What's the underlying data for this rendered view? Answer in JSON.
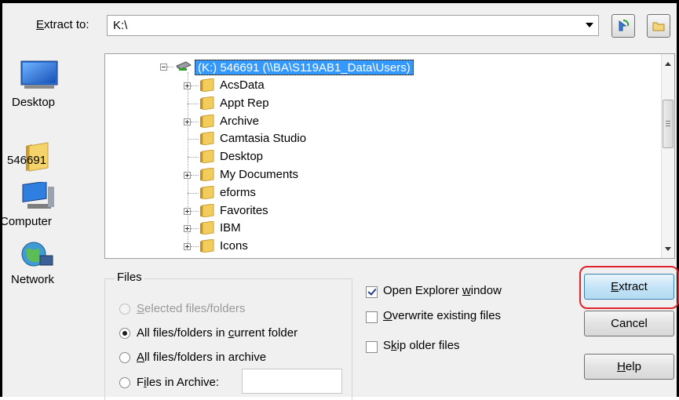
{
  "extract_to": {
    "label_prefix": "E",
    "label_rest": "xtract to:",
    "path": "K:\\"
  },
  "places": [
    {
      "label": "Desktop",
      "icon": "desktop-icon"
    },
    {
      "label": "546691",
      "icon": "user-folder-icon"
    },
    {
      "label": "Computer",
      "icon": "computer-icon"
    },
    {
      "label": "Network",
      "icon": "network-icon"
    }
  ],
  "tree": {
    "root": "(K:) 546691 (\\\\BA\\S119AB1_Data\\Users)",
    "items": [
      {
        "label": "AcsData",
        "expandable": true
      },
      {
        "label": "Appt Rep",
        "expandable": false
      },
      {
        "label": "Archive",
        "expandable": true
      },
      {
        "label": "Camtasia Studio",
        "expandable": false
      },
      {
        "label": "Desktop",
        "expandable": false
      },
      {
        "label": "My Documents",
        "expandable": true
      },
      {
        "label": "eforms",
        "expandable": false
      },
      {
        "label": "Favorites",
        "expandable": true
      },
      {
        "label": "IBM",
        "expandable": true
      },
      {
        "label": "Icons",
        "expandable": true
      }
    ]
  },
  "files_group": {
    "title": "Files",
    "options": [
      {
        "pre": "",
        "u": "S",
        "post": "elected files/folders",
        "checked": false,
        "disabled": true
      },
      {
        "pre": "All files/folders in ",
        "u": "c",
        "post": "urrent folder",
        "checked": true,
        "disabled": false
      },
      {
        "pre": "",
        "u": "A",
        "post": "ll files/folders in archive",
        "checked": false,
        "disabled": false
      },
      {
        "pre": "F",
        "u": "i",
        "post": "les in Archive:",
        "checked": false,
        "disabled": false
      }
    ],
    "files_in_archive_value": ""
  },
  "options": [
    {
      "pre": "Open Explorer ",
      "u": "w",
      "post": "indow",
      "checked": true
    },
    {
      "pre": "",
      "u": "O",
      "post": "verwrite existing files",
      "checked": false
    },
    {
      "pre": "S",
      "u": "k",
      "post": "ip older files",
      "checked": false
    }
  ],
  "buttons": {
    "extract": {
      "u": "E",
      "post": "xtract"
    },
    "cancel": "Cancel",
    "help": {
      "u": "H",
      "post": "elp"
    }
  },
  "colors": {
    "selection": "#3399ff",
    "highlight_ring": "#e0252c",
    "dialog_bg": "#f0f0f0"
  }
}
